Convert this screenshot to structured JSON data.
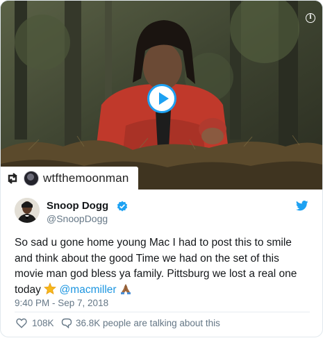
{
  "media": {
    "info_glyph": "i",
    "play_icon": "play-icon",
    "repost": {
      "icon": "repost-icon",
      "username": "wtfthemoonman"
    }
  },
  "author": {
    "name": "Snoop Dogg",
    "handle": "@SnoopDogg",
    "verified_icon": "verified-badge-icon",
    "platform_icon": "twitter-bird-icon"
  },
  "tweet": {
    "text_lines": [
      "So sad u gone home young Mac I had to post this to smile",
      "and think about the good Time we had on the set of this",
      "movie man god bless ya family. Pittsburg we lost a real one"
    ],
    "text_last_prefix": "today ",
    "mention": "@macmiller",
    "emojis": [
      "glowing-star",
      "folded-hands"
    ],
    "timestamp": "9:40 PM - Sep 7, 2018"
  },
  "actions": {
    "like_count": "108K",
    "talking": "36.8K people are talking about this"
  },
  "colors": {
    "accent": "#1da1f2",
    "link": "#1b95e0",
    "muted": "#657786",
    "text": "#14171a"
  }
}
